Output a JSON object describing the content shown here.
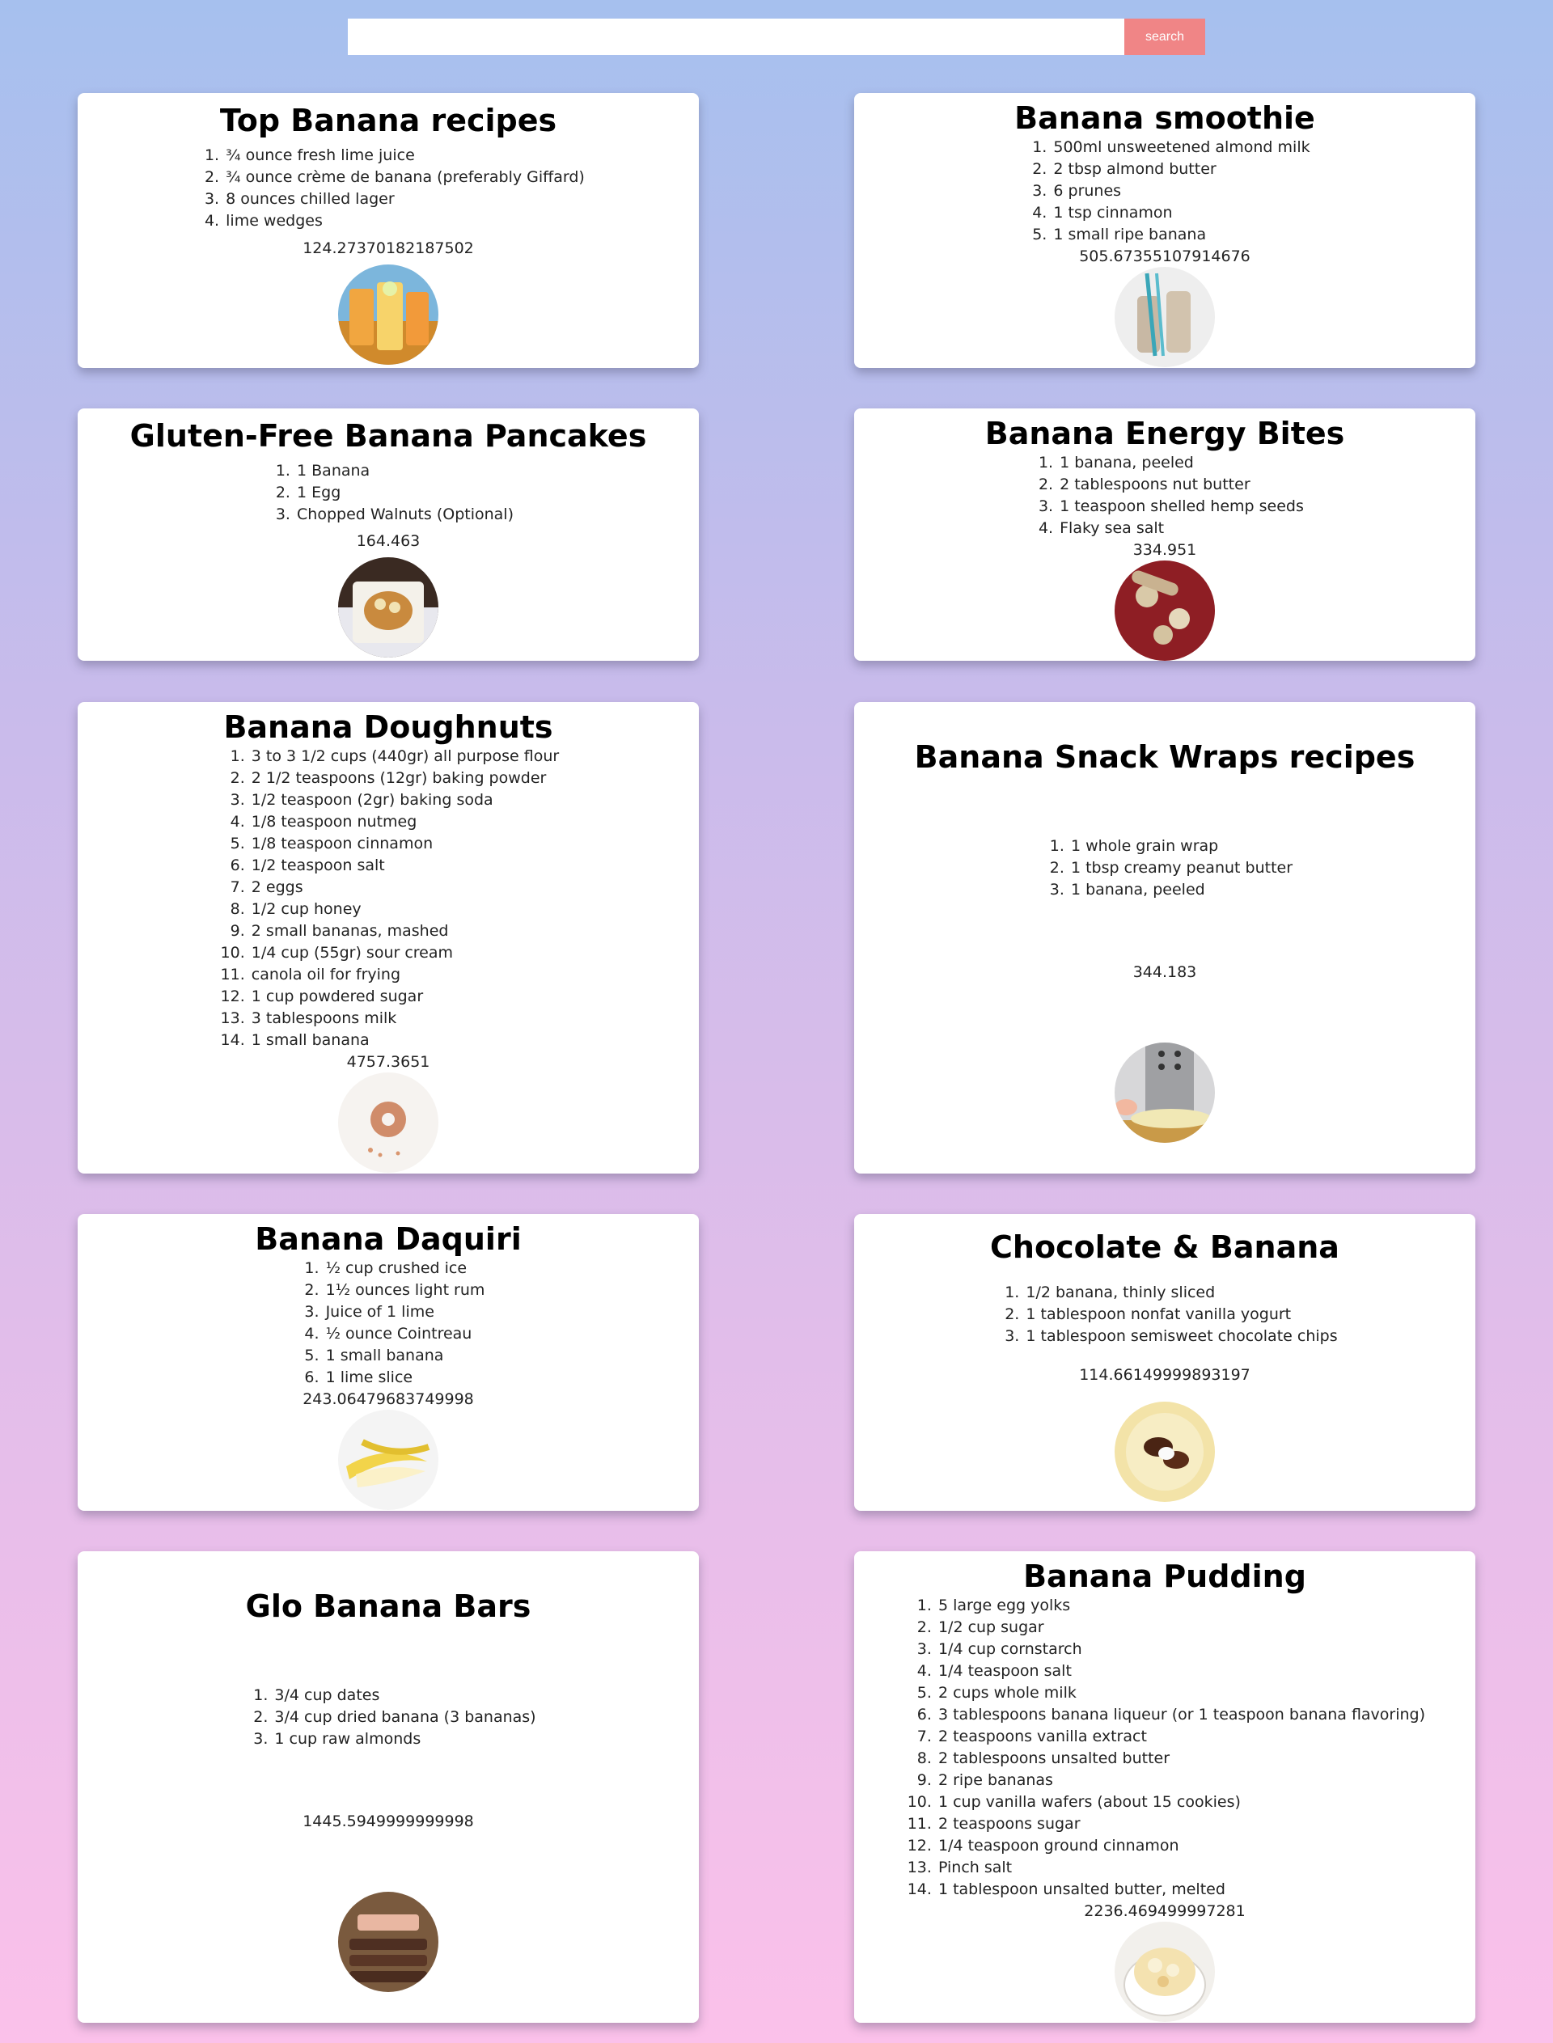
{
  "search": {
    "placeholder": "",
    "value": "",
    "button_label": "search"
  },
  "recipes": [
    {
      "title": "Top Banana recipes",
      "ingredients": [
        "¾ ounce fresh lime juice",
        "¾ ounce crème de banana (preferably Giffard)",
        "8 ounces chilled lager",
        "lime wedges"
      ],
      "calories": "124.27370182187502",
      "image": "banana-cocktail-photo"
    },
    {
      "title": "Banana smoothie",
      "ingredients": [
        "500ml unsweetened almond milk",
        "2 tbsp almond butter",
        "6 prunes",
        "1 tsp cinnamon",
        "1 small ripe banana"
      ],
      "calories": "505.67355107914676",
      "image": "smoothie-bottles-photo"
    },
    {
      "title": "Gluten-Free Banana Pancakes",
      "ingredients": [
        "1 Banana",
        "1 Egg",
        "Chopped Walnuts (Optional)"
      ],
      "calories": "164.463",
      "image": "pancake-plate-photo"
    },
    {
      "title": "Banana Energy Bites",
      "ingredients": [
        "1 banana, peeled",
        "2 tablespoons nut butter",
        "1 teaspoon shelled hemp seeds",
        "Flaky sea salt"
      ],
      "calories": "334.951",
      "image": "energy-bites-photo"
    },
    {
      "title": "Banana Doughnuts",
      "ingredients": [
        "3 to 3 1/2 cups (440gr) all purpose flour",
        "2 1/2 teaspoons (12gr) baking powder",
        "1/2 teaspoon (2gr) baking soda",
        "1/8 teaspoon nutmeg",
        "1/8 teaspoon cinnamon",
        "1/2 teaspoon salt",
        "2 eggs",
        "1/2 cup honey",
        "2 small bananas, mashed",
        "1/4 cup (55gr) sour cream",
        "canola oil for frying",
        "1 cup powdered sugar",
        "3 tablespoons milk",
        "1 small banana"
      ],
      "calories": "4757.3651",
      "image": "doughnut-photo"
    },
    {
      "title": "Banana Snack Wraps recipes",
      "ingredients": [
        "1 whole grain wrap",
        "1 tbsp creamy peanut butter",
        "1 banana, peeled"
      ],
      "calories": "344.183",
      "image": "chef-illustration"
    },
    {
      "title": "Banana Daquiri",
      "ingredients": [
        "½ cup crushed ice",
        "1½ ounces light rum",
        "Juice of 1 lime",
        "½ ounce Cointreau",
        "1 small banana",
        "1 lime slice"
      ],
      "calories": "243.06479683749998",
      "image": "peeled-banana-photo"
    },
    {
      "title": "Chocolate & Banana",
      "ingredients": [
        "1/2 banana, thinly sliced",
        "1 tablespoon nonfat vanilla yogurt",
        "1 tablespoon semisweet chocolate chips"
      ],
      "calories": "114.66149999893197",
      "image": "chocolate-banana-photo"
    },
    {
      "title": "Glo Banana Bars",
      "ingredients": [
        "3/4 cup dates",
        "3/4 cup dried banana (3 bananas)",
        "1 cup raw almonds"
      ],
      "calories": "1445.5949999999998",
      "image": "banana-bars-photo"
    },
    {
      "title": "Banana Pudding",
      "ingredients": [
        "5 large egg yolks",
        "1/2 cup sugar",
        "1/4 cup cornstarch",
        "1/4 teaspoon salt",
        "2 cups whole milk",
        "3 tablespoons banana liqueur (or 1 teaspoon banana flavoring)",
        "2 teaspoons vanilla extract",
        "2 tablespoons unsalted butter",
        "2 ripe bananas",
        "1 cup vanilla wafers (about 15 cookies)",
        "2 teaspoons sugar",
        "1/4 teaspoon ground cinnamon",
        "Pinch salt",
        "1 tablespoon unsalted butter, melted"
      ],
      "calories": "2236.469499997281",
      "image": "banana-pudding-photo"
    }
  ]
}
